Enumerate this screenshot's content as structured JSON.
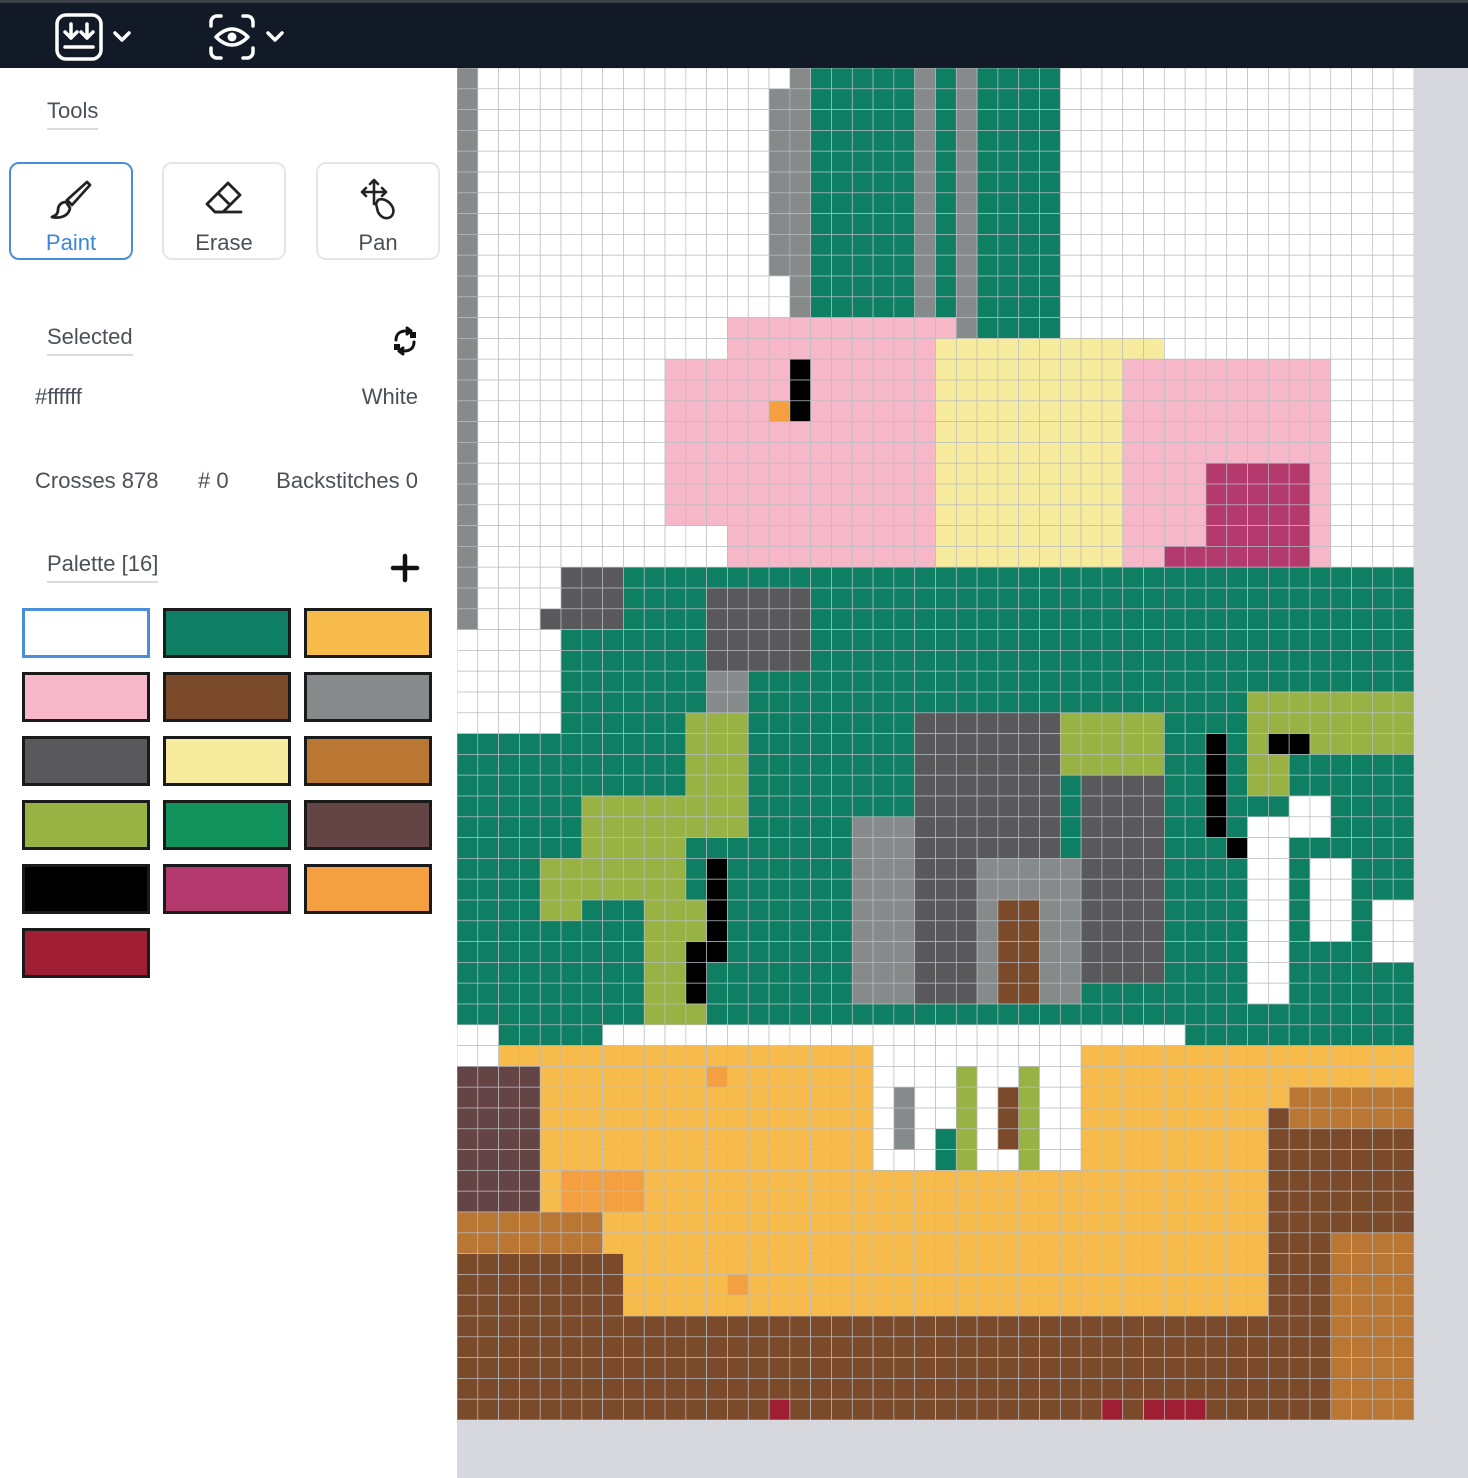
{
  "toolbar": {
    "export_icon": "download-icon",
    "view_icon": "eye-icon"
  },
  "tools": {
    "title": "Tools",
    "items": [
      {
        "label": "Paint",
        "icon": "brush-icon",
        "active": true
      },
      {
        "label": "Erase",
        "icon": "eraser-icon",
        "active": false
      },
      {
        "label": "Pan",
        "icon": "pan-icon",
        "active": false
      }
    ]
  },
  "selected": {
    "title": "Selected",
    "hex": "#ffffff",
    "name": "White",
    "swap_icon": "swap-icon"
  },
  "stats": {
    "crosses": "Crosses 878",
    "number": "# 0",
    "backstitches": "Backstitches 0"
  },
  "palette": {
    "title": "Palette [16]",
    "add_icon": "plus-icon",
    "colors": [
      "#ffffff",
      "#0e7f62",
      "#f7bb4c",
      "#f6b8c9",
      "#7a4a2b",
      "#868a8a",
      "#59595b",
      "#f7ec9e",
      "#b97733",
      "#99b244",
      "#11915b",
      "#644444",
      "#000000",
      "#b43a6e",
      "#f4a040",
      "#a01e33"
    ]
  },
  "pattern_colors": {
    "W": "#ffffff",
    "G": "#0e7f62",
    "P": "#f6b8c9",
    "Y": "#f7ec9e",
    "A": "#868a8a",
    "D": "#59595b",
    "O": "#f7bb4c",
    "B": "#7a4a2b",
    "C": "#b97733",
    "L": "#99b244",
    "K": "#000000",
    "M": "#b43a6e",
    "R": "#a01e33",
    "N": "#644444",
    "F": "#f4a040"
  }
}
